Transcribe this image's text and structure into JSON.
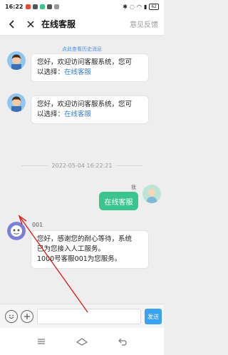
{
  "status_bar": {
    "time": "16:22",
    "battery": "62"
  },
  "nav": {
    "title": "在线客服",
    "feedback": "意见反馈"
  },
  "history_link": "点此查看历史消息",
  "messages": [
    {
      "line1": "您好，欢迎访问客服系统，您可",
      "line2_prefix": "以选择：",
      "link": "在线客服"
    },
    {
      "line1": "您好，欢迎访问客服系统，您可",
      "line2_prefix": "以选择：",
      "link": "在线客服"
    }
  ],
  "timestamp": "2022-05-04 16:22:21",
  "user_message": {
    "label": "我",
    "text": "在线客服"
  },
  "agent_message": {
    "name": "001",
    "lines": [
      "您好，感谢您的耐心等待，系统",
      "已为您接入人工服务。",
      "1000号客服001为您服务。"
    ]
  },
  "input": {
    "value": "",
    "placeholder": "",
    "send_label": "发送"
  },
  "colors": {
    "accent_green": "#3cc48f",
    "link_blue": "#2f7fd8",
    "send_blue": "#3aa3f0",
    "annotation_red": "#e02020"
  }
}
